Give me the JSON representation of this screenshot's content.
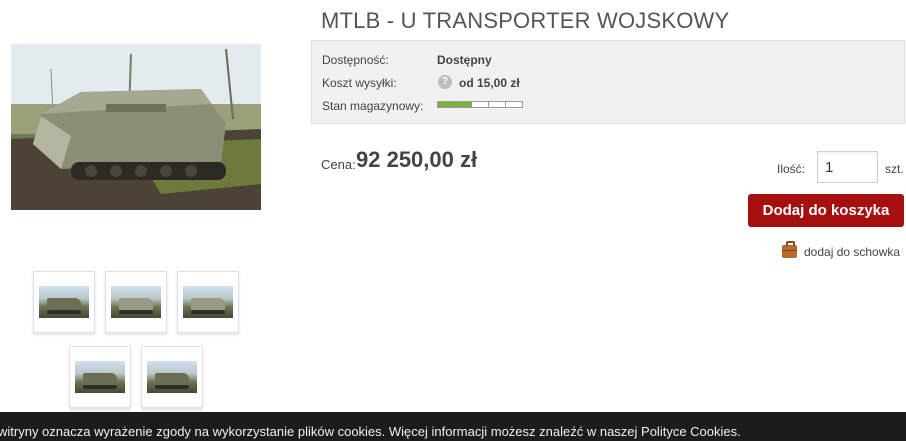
{
  "product": {
    "title": "MTLB - U TRANSPORTER WOJSKOWY",
    "main_image_alt": "MTLB - U TRANSPORTER WOJSKOWY"
  },
  "gallery": {
    "thumbnails": [
      "thumbnail-1",
      "thumbnail-2",
      "thumbnail-3",
      "thumbnail-4",
      "thumbnail-5"
    ]
  },
  "info": {
    "availability_label": "Dostępność:",
    "availability_value": "Dostępny",
    "shipping_label": "Koszt wysyłki:",
    "shipping_icon": "question-icon",
    "shipping_icon_glyph": "?",
    "shipping_value": "od 15,00 zł",
    "stock_label": "Stan magazynowy:",
    "stock_level_fraction": 0.4,
    "stock_level_color": "#7bb23a"
  },
  "price": {
    "label": "Cena:",
    "value": "92 250,00 zł"
  },
  "cart": {
    "qty_label": "Ilość:",
    "qty_value": "1",
    "qty_unit": "szt.",
    "add_button": "Dodaj do koszyka",
    "add_button_color": "#a50f0f",
    "wishlist_icon": "briefcase-icon",
    "wishlist_label": "dodaj do schowka"
  },
  "cookie": {
    "text": "witryny oznacza wyrażenie zgody na wykorzystanie plików cookies. Więcej informacji możesz znaleźć w naszej Polityce Cookies."
  }
}
